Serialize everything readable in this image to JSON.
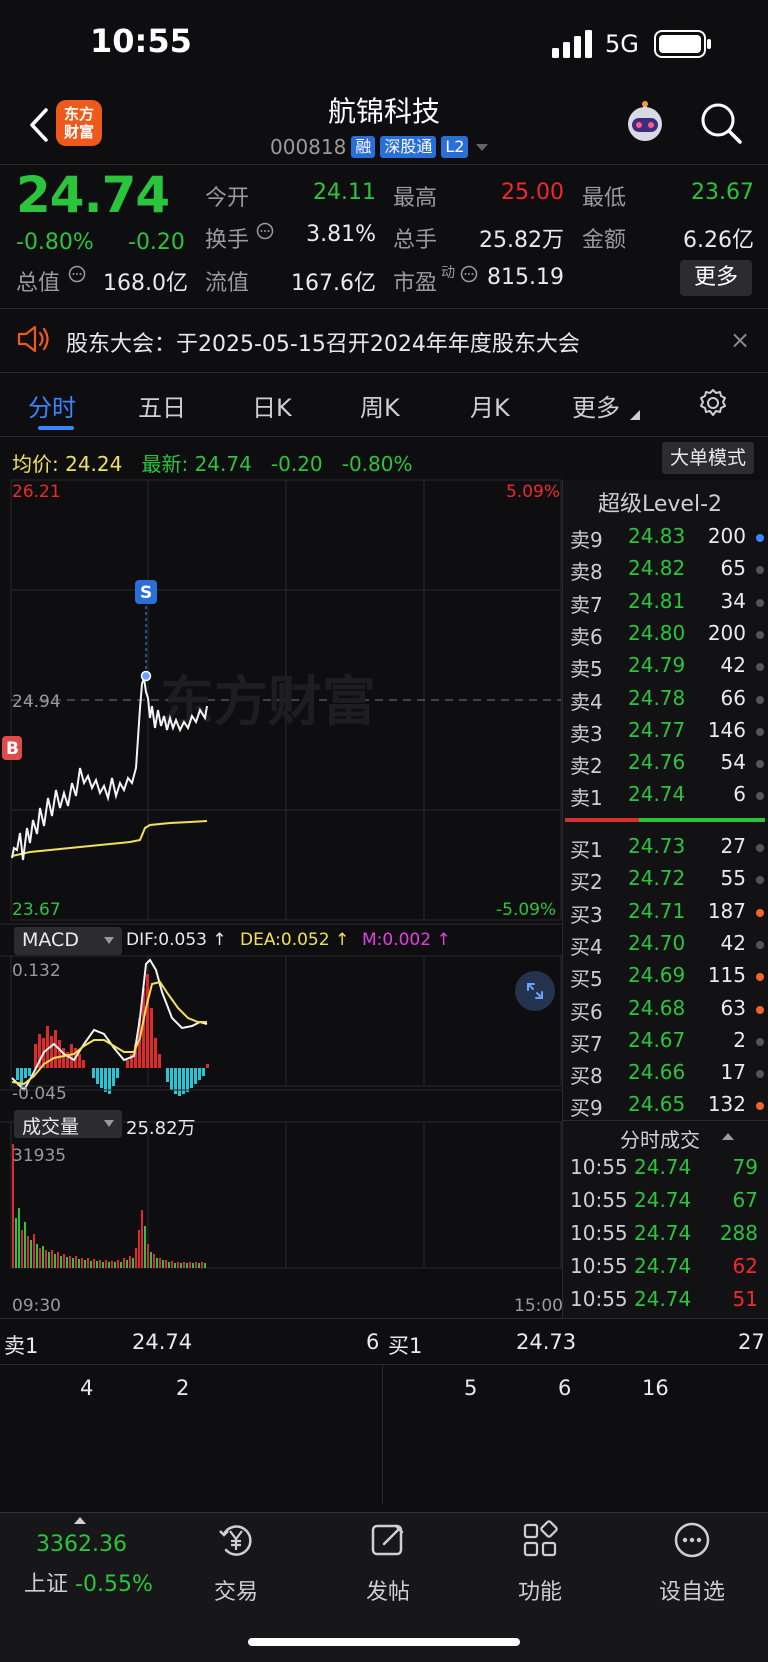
{
  "status": {
    "time": "10:55",
    "network": "5G"
  },
  "header": {
    "logo_text_line1": "东方",
    "logo_text_line2": "财富",
    "title": "航锦科技",
    "code": "000818",
    "tags": [
      "融",
      "深股通",
      "L2"
    ]
  },
  "quote": {
    "price": "24.74",
    "pct_change": "-0.80%",
    "abs_change": "-0.20",
    "open_label": "今开",
    "open": "24.11",
    "high_label": "最高",
    "high": "25.00",
    "low_label": "最低",
    "low": "23.67",
    "turnover_label": "换手",
    "turnover": "3.81%",
    "volume_label": "总手",
    "volume": "25.82万",
    "amount_label": "金额",
    "amount": "6.26亿",
    "mktcap_label": "总值",
    "mktcap": "168.0亿",
    "float_label": "流值",
    "float_cap": "167.6亿",
    "pe_label": "市盈",
    "pe_sup": "动",
    "pe": "815.19",
    "more_label": "更多"
  },
  "notice": {
    "text": "股东大会：于2025-05-15召开2024年年度股东大会",
    "close": "×"
  },
  "tabs": [
    "分时",
    "五日",
    "日K",
    "周K",
    "月K",
    "更多"
  ],
  "info_row": {
    "avg_label": "均价:",
    "avg": "24.24",
    "last_label": "最新:",
    "last": "24.74",
    "chg": "-0.20",
    "pct": "-0.80%",
    "bigorder_label": "大单模式"
  },
  "chart": {
    "price_high": "26.21",
    "price_low": "23.67",
    "ref_price": "24.94",
    "pct_high": "5.09%",
    "pct_low": "-5.09%",
    "marker_s": "S",
    "marker_b": "B",
    "watermark": "东方财富"
  },
  "macd": {
    "label": "MACD",
    "dif": "DIF:0.053 ↑",
    "dea": "DEA:0.052 ↑",
    "m": "M:0.002 ↑",
    "top": "0.132",
    "bottom": "-0.045"
  },
  "vol_panel": {
    "label": "成交量",
    "total": "25.82万",
    "max": "31935",
    "start_time": "09:30",
    "end_time": "15:00"
  },
  "orderbook": {
    "title": "超级Level-2",
    "asks": [
      {
        "label": "卖9",
        "price": "24.83",
        "vol": "200",
        "dot": "#3a86ff"
      },
      {
        "label": "卖8",
        "price": "24.82",
        "vol": "65",
        "dot": "#555555"
      },
      {
        "label": "卖7",
        "price": "24.81",
        "vol": "34",
        "dot": "#555555"
      },
      {
        "label": "卖6",
        "price": "24.80",
        "vol": "200",
        "dot": "#555555"
      },
      {
        "label": "卖5",
        "price": "24.79",
        "vol": "42",
        "dot": "#555555"
      },
      {
        "label": "卖4",
        "price": "24.78",
        "vol": "66",
        "dot": "#555555"
      },
      {
        "label": "卖3",
        "price": "24.77",
        "vol": "146",
        "dot": "#555555"
      },
      {
        "label": "卖2",
        "price": "24.76",
        "vol": "54",
        "dot": "#555555"
      },
      {
        "label": "卖1",
        "price": "24.74",
        "vol": "6",
        "dot": "#555555"
      }
    ],
    "bids": [
      {
        "label": "买1",
        "price": "24.73",
        "vol": "27",
        "dot": "#555555"
      },
      {
        "label": "买2",
        "price": "24.72",
        "vol": "55",
        "dot": "#555555"
      },
      {
        "label": "买3",
        "price": "24.71",
        "vol": "187",
        "dot": "#f0642a"
      },
      {
        "label": "买4",
        "price": "24.70",
        "vol": "42",
        "dot": "#555555"
      },
      {
        "label": "买5",
        "price": "24.69",
        "vol": "115",
        "dot": "#f0642a"
      },
      {
        "label": "买6",
        "price": "24.68",
        "vol": "63",
        "dot": "#f0642a"
      },
      {
        "label": "买7",
        "price": "24.67",
        "vol": "2",
        "dot": "#555555"
      },
      {
        "label": "买8",
        "price": "24.66",
        "vol": "17",
        "dot": "#555555"
      },
      {
        "label": "买9",
        "price": "24.65",
        "vol": "132",
        "dot": "#f0642a"
      }
    ],
    "trades_title": "分时成交",
    "trades": [
      {
        "time": "10:55",
        "price": "24.74",
        "vol": "79",
        "side": "green"
      },
      {
        "time": "10:55",
        "price": "24.74",
        "vol": "67",
        "side": "green"
      },
      {
        "time": "10:55",
        "price": "24.74",
        "vol": "288",
        "side": "green"
      },
      {
        "time": "10:55",
        "price": "24.74",
        "vol": "62",
        "side": "red"
      },
      {
        "time": "10:55",
        "price": "24.74",
        "vol": "51",
        "side": "red"
      }
    ]
  },
  "summary": {
    "ask_label": "卖1",
    "ask_price": "24.74",
    "ask_vol": "6",
    "bid_label": "买1",
    "bid_price": "24.73",
    "bid_vol": "27",
    "ask_queue": [
      "4",
      "2"
    ],
    "bid_queue": [
      "5",
      "6",
      "16"
    ]
  },
  "bottom_nav": {
    "index_value": "3362.36",
    "index_name": "上证",
    "index_pct": "-0.55%",
    "items": [
      "交易",
      "发帖",
      "功能",
      "设自选"
    ]
  }
}
